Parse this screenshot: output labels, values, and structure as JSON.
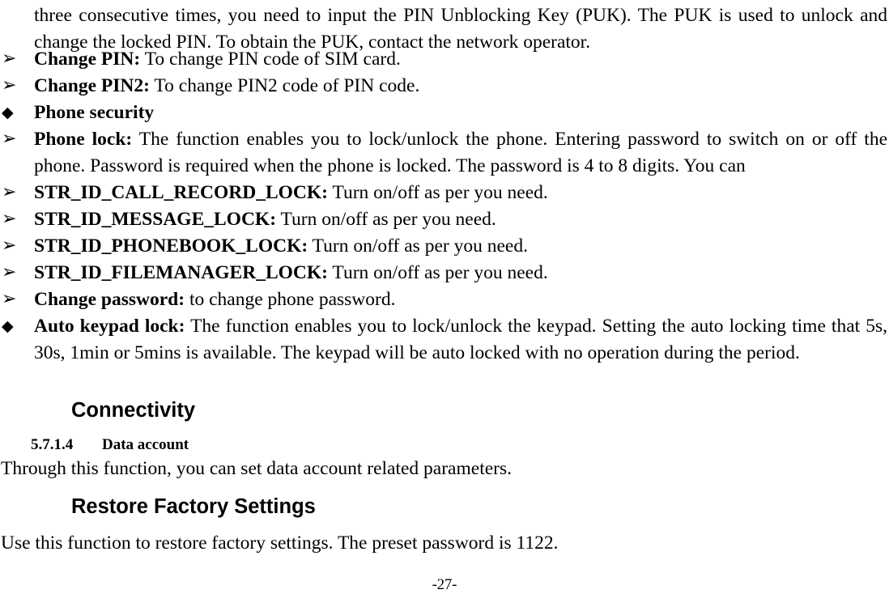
{
  "page": {
    "number_label": "-27-"
  },
  "continued_paragraph": {
    "line1": "three consecutive times, you need to input the PIN Unblocking Key (PUK). The PUK is used to unlock",
    "line2": "and change the locked PIN. To obtain the PUK, contact the network operator."
  },
  "bullets": {
    "arrow": "➢",
    "diamond": "◆"
  },
  "list": [
    {
      "marker": "arrow",
      "term": "Change PIN:",
      "text": " To change PIN code of SIM card."
    },
    {
      "marker": "arrow",
      "term": "Change PIN2:",
      "text": " To change PIN2 code of PIN code."
    },
    {
      "marker": "diamond",
      "term": "Phone security",
      "text": ""
    },
    {
      "marker": "arrow",
      "term": "Phone lock:",
      "text": " The function enables you to lock/unlock the phone. Entering password to switch on or off the phone. Password is required when the phone is locked. The password is 4 to 8 digits. You can"
    },
    {
      "marker": "arrow",
      "term": "STR_ID_CALL_RECORD_LOCK:",
      "text": " Turn on/off as per you need."
    },
    {
      "marker": "arrow",
      "term": "STR_ID_MESSAGE_LOCK:",
      "text": " Turn on/off as per you need."
    },
    {
      "marker": "arrow",
      "term": "STR_ID_PHONEBOOK_LOCK:",
      "text": " Turn on/off as per you need."
    },
    {
      "marker": "arrow",
      "term": "STR_ID_FILEMANAGER_LOCK:",
      "text": " Turn on/off as per you need."
    },
    {
      "marker": "arrow",
      "term": "Change password:",
      "text": " to change phone password."
    },
    {
      "marker": "diamond",
      "term": "Auto keypad lock:",
      "text": " The function enables you to lock/unlock the keypad. Setting the auto locking time that 5s, 30s, 1min or 5mins is available. The keypad will be auto locked with no operation during the period."
    }
  ],
  "sections": [
    {
      "heading": "Connectivity",
      "number": "5.7.1.4",
      "subheading": "Data account",
      "body": "Through this function, you can set data account related parameters."
    },
    {
      "heading": "Restore Factory Settings",
      "body": "Use this function to restore factory settings. The preset password is 1122."
    }
  ]
}
